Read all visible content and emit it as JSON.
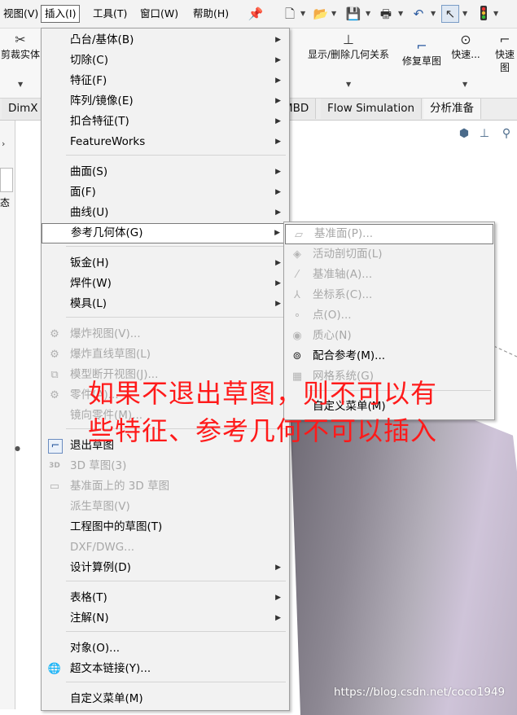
{
  "menubar": {
    "items": [
      "视图(V)",
      "插入(I)",
      "工具(T)",
      "窗口(W)",
      "帮助(H)"
    ],
    "pin_icon": "pin-icon"
  },
  "quick_access": [
    "new-document-icon",
    "open-folder-icon",
    "save-icon",
    "print-icon",
    "undo-icon",
    "select-pointer-icon",
    "traffic-light-icon"
  ],
  "ribbon": {
    "trim_solid": "剪裁实体",
    "show_delete_relations": "显示/删除几何关系",
    "repair_sketch": "修复草图",
    "quick1": "快速...",
    "quick2": "快速图"
  },
  "tabs": [
    "DimX",
    "MBD",
    "Flow Simulation",
    "分析准备"
  ],
  "left_panel_text": "态",
  "main_menu": {
    "items": [
      {
        "label": "凸台/基体(B)",
        "arrow": true,
        "disabled": false,
        "icon": ""
      },
      {
        "label": "切除(C)",
        "arrow": true,
        "disabled": false,
        "icon": ""
      },
      {
        "label": "特征(F)",
        "arrow": true,
        "disabled": false,
        "icon": ""
      },
      {
        "label": "阵列/镜像(E)",
        "arrow": true,
        "disabled": false,
        "icon": ""
      },
      {
        "label": "扣合特征(T)",
        "arrow": true,
        "disabled": false,
        "icon": ""
      },
      {
        "label": "FeatureWorks",
        "arrow": true,
        "disabled": false,
        "icon": ""
      },
      {
        "label": "曲面(S)",
        "arrow": true,
        "disabled": false,
        "icon": ""
      },
      {
        "label": "面(F)",
        "arrow": true,
        "disabled": false,
        "icon": ""
      },
      {
        "label": "曲线(U)",
        "arrow": true,
        "disabled": false,
        "icon": ""
      },
      {
        "label": "参考几何体(G)",
        "arrow": true,
        "disabled": false,
        "icon": "",
        "highlighted": true
      },
      {
        "label": "钣金(H)",
        "arrow": true,
        "disabled": false,
        "icon": ""
      },
      {
        "label": "焊件(W)",
        "arrow": true,
        "disabled": false,
        "icon": ""
      },
      {
        "label": "模具(L)",
        "arrow": true,
        "disabled": false,
        "icon": ""
      },
      {
        "label": "爆炸视图(V)...",
        "arrow": false,
        "disabled": true,
        "icon": "explode-view-icon"
      },
      {
        "label": "爆炸直线草图(L)",
        "arrow": false,
        "disabled": true,
        "icon": "explode-line-icon"
      },
      {
        "label": "模型断开视图(J)...",
        "arrow": false,
        "disabled": true,
        "icon": "break-view-icon"
      },
      {
        "label": "零件(A)...",
        "arrow": false,
        "disabled": true,
        "icon": "part-icon"
      },
      {
        "label": "镜向零件(M)...",
        "arrow": false,
        "disabled": true,
        "icon": ""
      },
      {
        "label": "退出草图",
        "arrow": false,
        "disabled": false,
        "icon": "exit-sketch-icon"
      },
      {
        "label": "3D 草图(3)",
        "arrow": false,
        "disabled": true,
        "icon": "3d-sketch-icon"
      },
      {
        "label": "基准面上的 3D 草图",
        "arrow": false,
        "disabled": true,
        "icon": "3d-sketch-plane-icon"
      },
      {
        "label": "派生草图(V)",
        "arrow": false,
        "disabled": true,
        "icon": ""
      },
      {
        "label": "工程图中的草图(T)",
        "arrow": false,
        "disabled": false,
        "icon": ""
      },
      {
        "label": "DXF/DWG...",
        "arrow": false,
        "disabled": true,
        "icon": ""
      },
      {
        "label": "设计算例(D)",
        "arrow": true,
        "disabled": false,
        "icon": ""
      },
      {
        "label": "表格(T)",
        "arrow": true,
        "disabled": false,
        "icon": ""
      },
      {
        "label": "注解(N)",
        "arrow": true,
        "disabled": false,
        "icon": ""
      },
      {
        "label": "对象(O)...",
        "arrow": false,
        "disabled": false,
        "icon": ""
      },
      {
        "label": "超文本链接(Y)...",
        "arrow": false,
        "disabled": false,
        "icon": "hyperlink-globe-icon"
      },
      {
        "label": "自定义菜单(M)",
        "arrow": false,
        "disabled": false,
        "icon": ""
      }
    ]
  },
  "sub_menu": {
    "items": [
      {
        "label": "基准面(P)...",
        "disabled": true,
        "icon": "plane-icon",
        "highlighted": true
      },
      {
        "label": "活动剖切面(L)",
        "disabled": true,
        "icon": "section-plane-icon"
      },
      {
        "label": "基准轴(A)...",
        "disabled": true,
        "icon": "axis-icon"
      },
      {
        "label": "坐标系(C)...",
        "disabled": true,
        "icon": "coordinate-system-icon"
      },
      {
        "label": "点(O)...",
        "disabled": true,
        "icon": "point-icon"
      },
      {
        "label": "质心(N)",
        "disabled": true,
        "icon": "center-of-mass-icon"
      },
      {
        "label": "配合参考(M)...",
        "disabled": false,
        "icon": "mate-reference-icon"
      },
      {
        "label": "网格系统(G)",
        "disabled": true,
        "icon": "grid-system-icon"
      },
      {
        "label": "自定义菜单(M)",
        "disabled": false,
        "icon": ""
      }
    ]
  },
  "annotation": "如果不退出草图，则不可以有\n些特征、参考几何不可以插入",
  "watermark": "https://blog.csdn.net/coco1949",
  "colors": {
    "annotation": "#ff1a1a",
    "menu_bg": "#f2f2f2",
    "disabled": "#a8a8a8"
  }
}
